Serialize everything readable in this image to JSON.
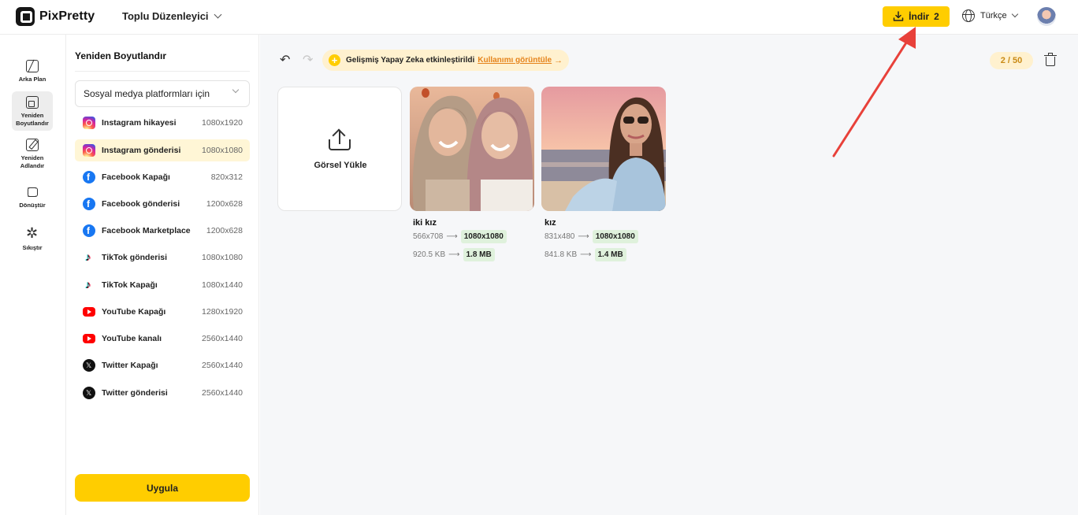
{
  "header": {
    "app_name": "PixPretty",
    "mode_label": "Toplu Düzenleyici",
    "download_label": "İndir",
    "download_count": "2",
    "language_label": "Türkçe"
  },
  "rail": {
    "items": [
      {
        "label": "Arka Plan"
      },
      {
        "label": "Yeniden Boyutlandır"
      },
      {
        "label": "Yeniden Adlandır"
      },
      {
        "label": "Dönüştür"
      },
      {
        "label": "Sıkıştır"
      }
    ]
  },
  "panel": {
    "title": "Yeniden Boyutlandır",
    "platform_select": "Sosyal medya platformları için",
    "presets": [
      {
        "name": "Instagram hikayesi",
        "size": "1080x1920",
        "icon": "instagram-icon"
      },
      {
        "name": "Instagram gönderisi",
        "size": "1080x1080",
        "icon": "instagram-icon"
      },
      {
        "name": "Facebook Kapağı",
        "size": "820x312",
        "icon": "facebook-icon"
      },
      {
        "name": "Facebook gönderisi",
        "size": "1200x628",
        "icon": "facebook-icon"
      },
      {
        "name": "Facebook Marketplace",
        "size": "1200x628",
        "icon": "facebook-icon"
      },
      {
        "name": "TikTok gönderisi",
        "size": "1080x1080",
        "icon": "tiktok-icon"
      },
      {
        "name": "TikTok Kapağı",
        "size": "1080x1440",
        "icon": "tiktok-icon"
      },
      {
        "name": "YouTube Kapağı",
        "size": "1280x1920",
        "icon": "youtube-icon"
      },
      {
        "name": "YouTube kanalı",
        "size": "2560x1440",
        "icon": "youtube-icon"
      },
      {
        "name": "Twitter Kapağı",
        "size": "2560x1440",
        "icon": "x-icon"
      },
      {
        "name": "Twitter gönderisi",
        "size": "2560x1440",
        "icon": "x-icon"
      }
    ],
    "selected_preset": "Instagram gönderisi",
    "apply_label": "Uygula"
  },
  "main": {
    "ai_text": "Gelişmiş Yapay Zeka etkinleştirildi",
    "ai_link": "Kullanımı görüntüle",
    "counter": "2 / 50",
    "upload_label": "Görsel Yükle",
    "images": [
      {
        "name": "iki kız",
        "orig_dims": "566x708",
        "new_dims": "1080x1080",
        "orig_size": "920.5 KB",
        "new_size": "1.8 MB"
      },
      {
        "name": "kız",
        "orig_dims": "831x480",
        "new_dims": "1080x1080",
        "orig_size": "841.8 KB",
        "new_size": "1.4 MB"
      }
    ]
  },
  "colors": {
    "accent": "#ffcd00",
    "selected_bg": "#fff6d6",
    "tag_bg": "#dff1dc",
    "annotation": "#e8413a"
  }
}
